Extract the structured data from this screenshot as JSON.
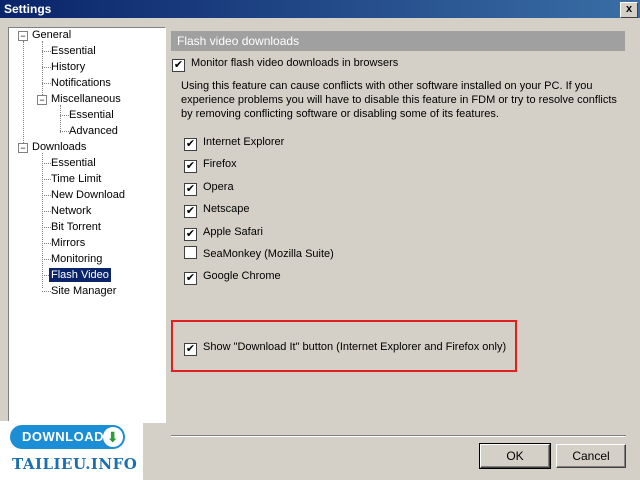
{
  "window": {
    "title": "Settings",
    "close_glyph": "x"
  },
  "tree": {
    "general": "General",
    "general_essential": "Essential",
    "general_history": "History",
    "general_notifications": "Notifications",
    "miscellaneous": "Miscellaneous",
    "misc_essential": "Essential",
    "misc_advanced": "Advanced",
    "downloads": "Downloads",
    "dl_essential": "Essential",
    "dl_time_limit": "Time Limit",
    "dl_new_download": "New Download",
    "dl_network": "Network",
    "dl_bittorrent": "Bit Torrent",
    "dl_mirrors": "Mirrors",
    "dl_monitoring": "Monitoring",
    "dl_flash_video": "Flash Video",
    "dl_site_manager": "Site Manager",
    "expanded_glyph": "−",
    "selected": "Flash Video"
  },
  "panel": {
    "header": "Flash video downloads",
    "monitor_label": "Monitor flash video downloads in browsers",
    "monitor_checked": true,
    "description": "Using this feature can cause conflicts with other software installed on your PC. If you experience problems you will have to disable this feature in FDM or try to resolve conflicts by removing conflicting software or disabling some of its features.",
    "browsers": [
      {
        "label": "Internet Explorer",
        "checked": true
      },
      {
        "label": "Firefox",
        "checked": true
      },
      {
        "label": "Opera",
        "checked": true
      },
      {
        "label": "Netscape",
        "checked": true
      },
      {
        "label": "Apple Safari",
        "checked": true
      },
      {
        "label": "SeaMonkey (Mozilla Suite)",
        "checked": false
      },
      {
        "label": "Google Chrome",
        "checked": true
      }
    ],
    "download_it_label": "Show \"Download It\" button (Internet Explorer and Firefox only)",
    "download_it_checked": true,
    "check_glyph": "✔"
  },
  "buttons": {
    "ok": "OK",
    "cancel": "Cancel"
  },
  "watermark": {
    "badge": "DOWNLOAD",
    "site": "TAILIEU.INFO",
    "arrow_glyph": "⬇"
  },
  "colors": {
    "highlight": "#e02020",
    "selection": "#0a246a",
    "header": "#a0a0a0"
  }
}
